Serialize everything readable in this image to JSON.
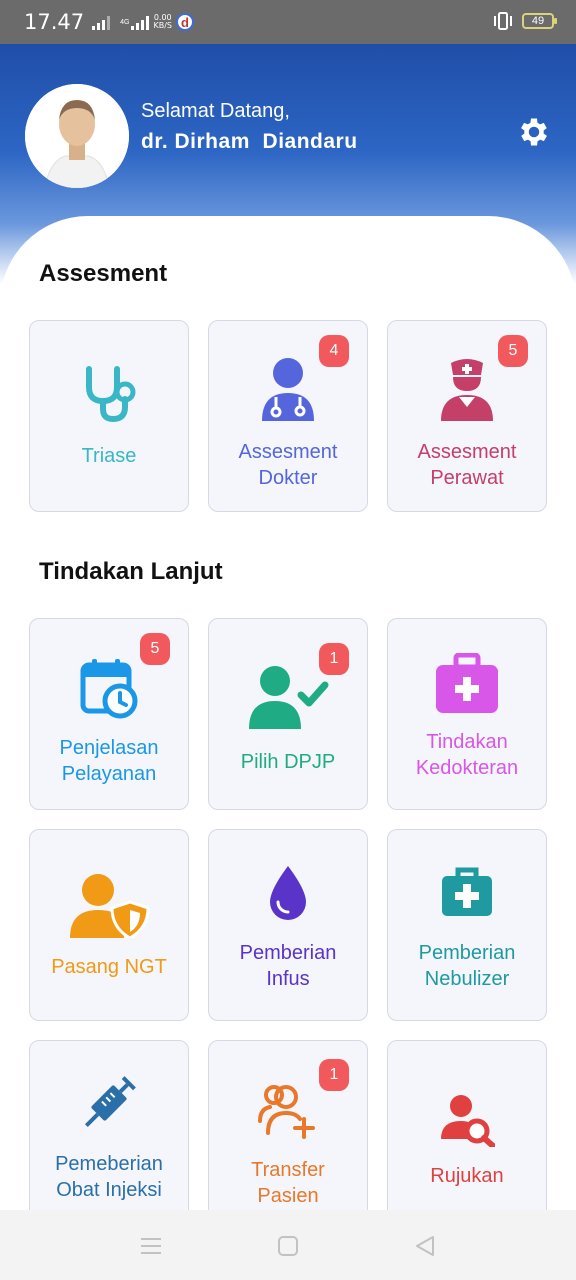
{
  "status_bar": {
    "time": "17.47",
    "network_tag": "4G",
    "speed_value": "0.00",
    "speed_unit": "KB/S",
    "app_icon_letter": "d",
    "battery": "49"
  },
  "header": {
    "greeting": "Selamat Datang,",
    "user_name": "dr. Dirham  Diandaru"
  },
  "sections": {
    "assesment_title": "Assesment",
    "tindakan_title": "Tindakan Lanjut"
  },
  "cards": {
    "triase": {
      "line1": "Triase",
      "color": "#3ab7c6",
      "icon": "stethoscope-icon"
    },
    "assesment_dokter": {
      "line1": "Assesment",
      "line2": "Dokter",
      "badge": "4",
      "color": "#5566dd",
      "icon": "doctor-icon"
    },
    "assesment_perawat": {
      "line1": "Assesment",
      "line2": "Perawat",
      "badge": "5",
      "color": "#c44069",
      "icon": "nurse-icon"
    },
    "penjelasan_pelayanan": {
      "line1": "Penjelasan",
      "line2": "Pelayanan",
      "badge": "5",
      "color": "#1a97e6",
      "icon": "calendar-clock-icon"
    },
    "pilih_dpjp": {
      "line1": "Pilih DPJP",
      "badge": "1",
      "color": "#1fac84",
      "icon": "user-check-icon"
    },
    "tindakan_kedokteran": {
      "line1": "Tindakan",
      "line2": "Kedokteran",
      "color": "#d856e8",
      "icon": "medical-kit-icon"
    },
    "pasang_ngt": {
      "line1": "Pasang NGT",
      "color": "#f09a16",
      "icon": "user-shield-icon"
    },
    "pemberian_infus": {
      "line1": "Pemberian",
      "line2": "Infus",
      "color": "#5a33c8",
      "icon": "drop-icon"
    },
    "pemberian_nebulizer": {
      "line1": "Pemberian",
      "line2": "Nebulizer",
      "color": "#1f9aa0",
      "icon": "medical-bag-icon"
    },
    "pemeberian_obat_injeksi": {
      "line1": "Pemeberian",
      "line2": "Obat Injeksi",
      "color": "#2a6fa8",
      "icon": "syringe-icon"
    },
    "transfer_pasien": {
      "line1": "Transfer",
      "line2": "Pasien",
      "badge": "1",
      "color": "#e9782a",
      "icon": "user-plus-icon"
    },
    "rujukan": {
      "line1": "Rujukan",
      "color": "#e0403f",
      "icon": "user-search-icon"
    }
  },
  "nav": {
    "icons": [
      "menu-icon",
      "home-icon",
      "back-icon"
    ]
  }
}
